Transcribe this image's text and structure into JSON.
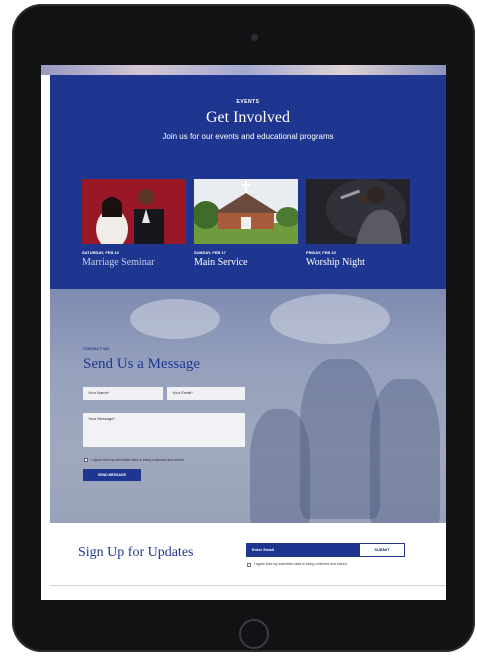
{
  "events": {
    "kicker": "EVENTS",
    "title": "Get Involved",
    "subtitle": "Join us for our events and educational programs",
    "cards": [
      {
        "date": "SATURDAY, FEB 10",
        "name": "Marriage Seminar"
      },
      {
        "date": "SUNDAY, FEB 17",
        "name": "Main Service"
      },
      {
        "date": "FRIDAY, FEB 23",
        "name": "Worship Night"
      }
    ]
  },
  "contact": {
    "kicker": "CONTACT US",
    "title": "Send Us a Message",
    "name_placeholder": "Your Name*",
    "email_placeholder": "Your Email*",
    "message_placeholder": "Your Message*",
    "consent": "I agree that my submitted data is being collected and stored.",
    "button": "SEND MESSAGE"
  },
  "signup": {
    "title": "Sign Up for Updates",
    "email_placeholder": "Enter Email",
    "submit": "SUBMIT",
    "consent": "I agree that my submitted data is being collected and stored."
  },
  "colors": {
    "brand_blue": "#1f3690",
    "device_frame": "#111214"
  }
}
